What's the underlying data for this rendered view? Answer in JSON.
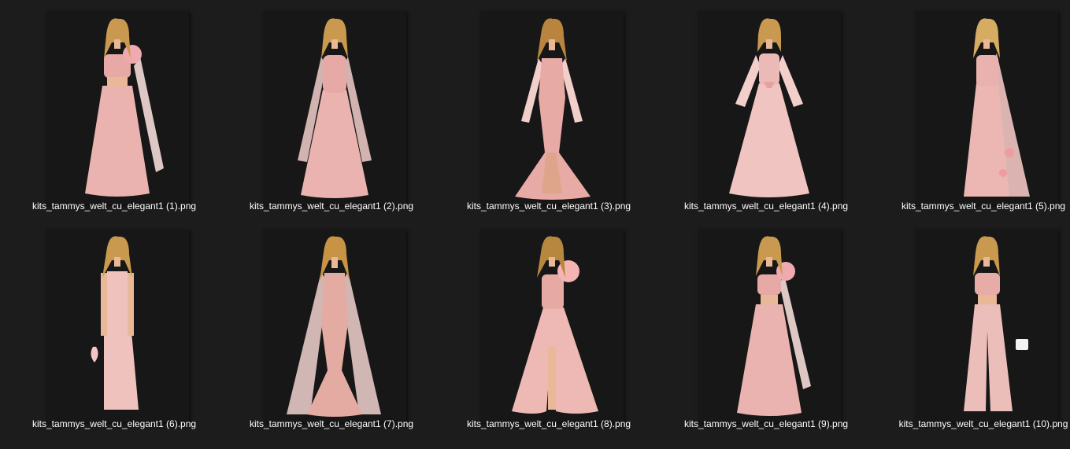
{
  "files": [
    {
      "name": "kits_tammys_welt_cu_elegant1 (1).png",
      "icon": "pink-gown-rose-cape-icon"
    },
    {
      "name": "kits_tammys_welt_cu_elegant1 (2).png",
      "icon": "pink-gown-cape-sleeves-icon"
    },
    {
      "name": "kits_tammys_welt_cu_elegant1 (3).png",
      "icon": "pink-mermaid-gown-icon"
    },
    {
      "name": "kits_tammys_welt_cu_elegant1 (4).png",
      "icon": "pink-bow-gown-icon"
    },
    {
      "name": "kits_tammys_welt_cu_elegant1 (5).png",
      "icon": "pink-saree-gown-icon"
    },
    {
      "name": "kits_tammys_welt_cu_elegant1 (6).png",
      "icon": "pink-column-dress-icon"
    },
    {
      "name": "kits_tammys_welt_cu_elegant1 (7).png",
      "icon": "pink-sequin-mermaid-gown-icon"
    },
    {
      "name": "kits_tammys_welt_cu_elegant1 (8).png",
      "icon": "pink-slit-gown-icon"
    },
    {
      "name": "kits_tammys_welt_cu_elegant1 (9).png",
      "icon": "pink-crop-top-skirt-icon"
    },
    {
      "name": "kits_tammys_welt_cu_elegant1 (10).png",
      "icon": "pink-palazzo-set-icon"
    }
  ],
  "colors": {
    "background": "#1c1c1c",
    "thumb_background": "#171717",
    "gown": "#eab3b0",
    "gown_light": "#f4cfca",
    "skin": "#e9b896",
    "hair": "#c9994f",
    "label_text": "#ffffff"
  }
}
